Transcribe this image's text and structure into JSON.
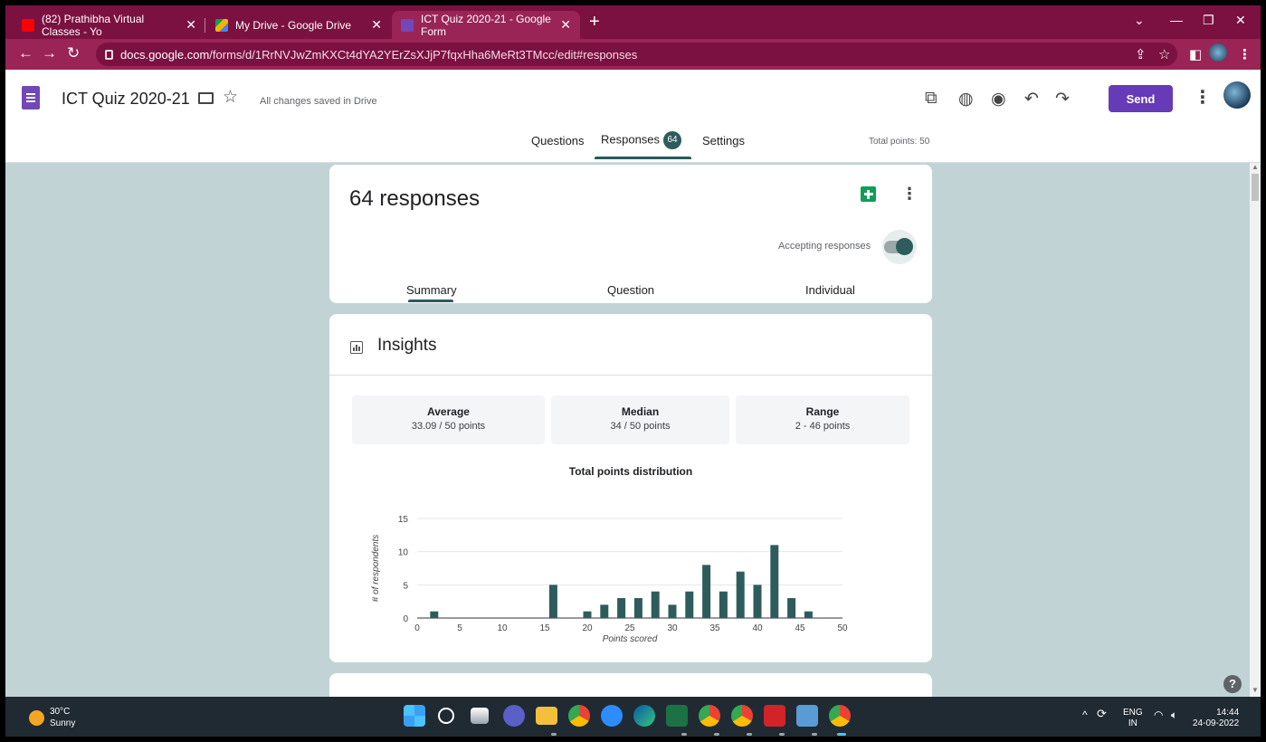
{
  "browser": {
    "tabs": [
      {
        "title": "(82) Prathibha Virtual Classes - Yo"
      },
      {
        "title": "My Drive - Google Drive"
      },
      {
        "title": "ICT Quiz 2020-21 - Google Form"
      }
    ],
    "url_domain": "docs.google.com",
    "url_path": "/forms/d/1RrNVJwZmKXCt4dYA2YErZsXJjP7fqxHha6MeRt3TMcc/edit#responses"
  },
  "form_header": {
    "title": "ICT Quiz 2020-21",
    "save_status": "All changes saved in Drive",
    "send_label": "Send",
    "tabs": [
      "Questions",
      "Responses",
      "Settings"
    ],
    "responses_badge": "64",
    "total_points": "Total points: 50"
  },
  "summary": {
    "responses_title": "64 responses",
    "accepting_label": "Accepting responses",
    "accepting": true,
    "subtabs": [
      "Summary",
      "Question",
      "Individual"
    ]
  },
  "insights": {
    "title": "Insights",
    "stats": [
      {
        "label": "Average",
        "value": "33.09 / 50 points"
      },
      {
        "label": "Median",
        "value": "34 / 50 points"
      },
      {
        "label": "Range",
        "value": "2 - 46 points"
      }
    ]
  },
  "chart_data": {
    "type": "bar",
    "title": "Total points distribution",
    "xlabel": "Points scored",
    "ylabel": "# of respondents",
    "xlim": [
      0,
      50
    ],
    "ylim": [
      0,
      15
    ],
    "xticks": [
      0,
      5,
      10,
      15,
      20,
      25,
      30,
      35,
      40,
      45,
      50
    ],
    "yticks": [
      0,
      5,
      10,
      15
    ],
    "x": [
      2,
      16,
      20,
      22,
      24,
      26,
      28,
      30,
      32,
      34,
      36,
      38,
      40,
      42,
      44,
      46
    ],
    "values": [
      1,
      5,
      1,
      2,
      3,
      3,
      4,
      2,
      4,
      8,
      4,
      7,
      5,
      11,
      3,
      1
    ],
    "bar_color": "#2e5c5c",
    "grid": true
  },
  "taskbar": {
    "temp": "30°C",
    "condition": "Sunny",
    "lang_top": "ENG",
    "lang_bottom": "IN",
    "time": "14:44",
    "date": "24-09-2022"
  }
}
